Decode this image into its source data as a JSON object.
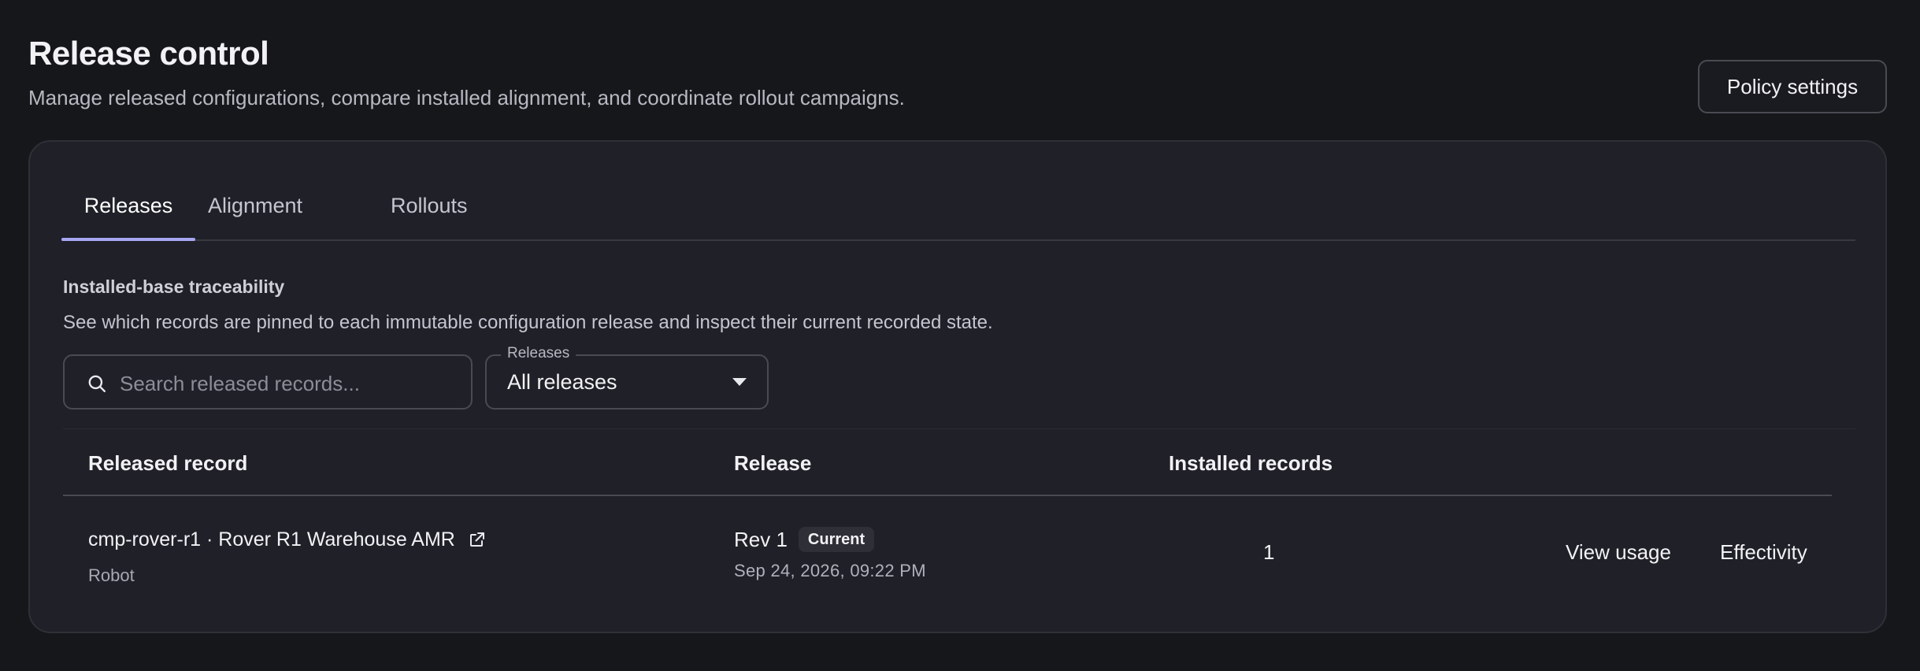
{
  "header": {
    "title": "Release control",
    "subtitle": "Manage released configurations, compare installed alignment, and coordinate rollout campaigns.",
    "policy_button": "Policy settings"
  },
  "tabs": [
    {
      "label": "Releases",
      "active": true
    },
    {
      "label": "Alignment",
      "active": false
    },
    {
      "label": "Rollouts",
      "active": false
    }
  ],
  "section": {
    "title": "Installed-base traceability",
    "description": "See which records are pinned to each immutable configuration release and inspect their current recorded state."
  },
  "filters": {
    "search_placeholder": "Search released records...",
    "search_value": "",
    "select_label": "Releases",
    "select_value": "All releases"
  },
  "table": {
    "columns": [
      "Released record",
      "Release",
      "Installed records"
    ],
    "rows": [
      {
        "record": "cmp-rover-r1 · Rover R1 Warehouse AMR",
        "record_type": "Robot",
        "release": "Rev 1",
        "badge": "Current",
        "date": "Sep 24, 2026, 09:22 PM",
        "installed": "1",
        "action_usage": "View usage",
        "action_effectivity": "Effectivity"
      }
    ]
  },
  "colors": {
    "background": "#16171b",
    "card": "#1f2028",
    "accent": "#a7a6f2"
  }
}
